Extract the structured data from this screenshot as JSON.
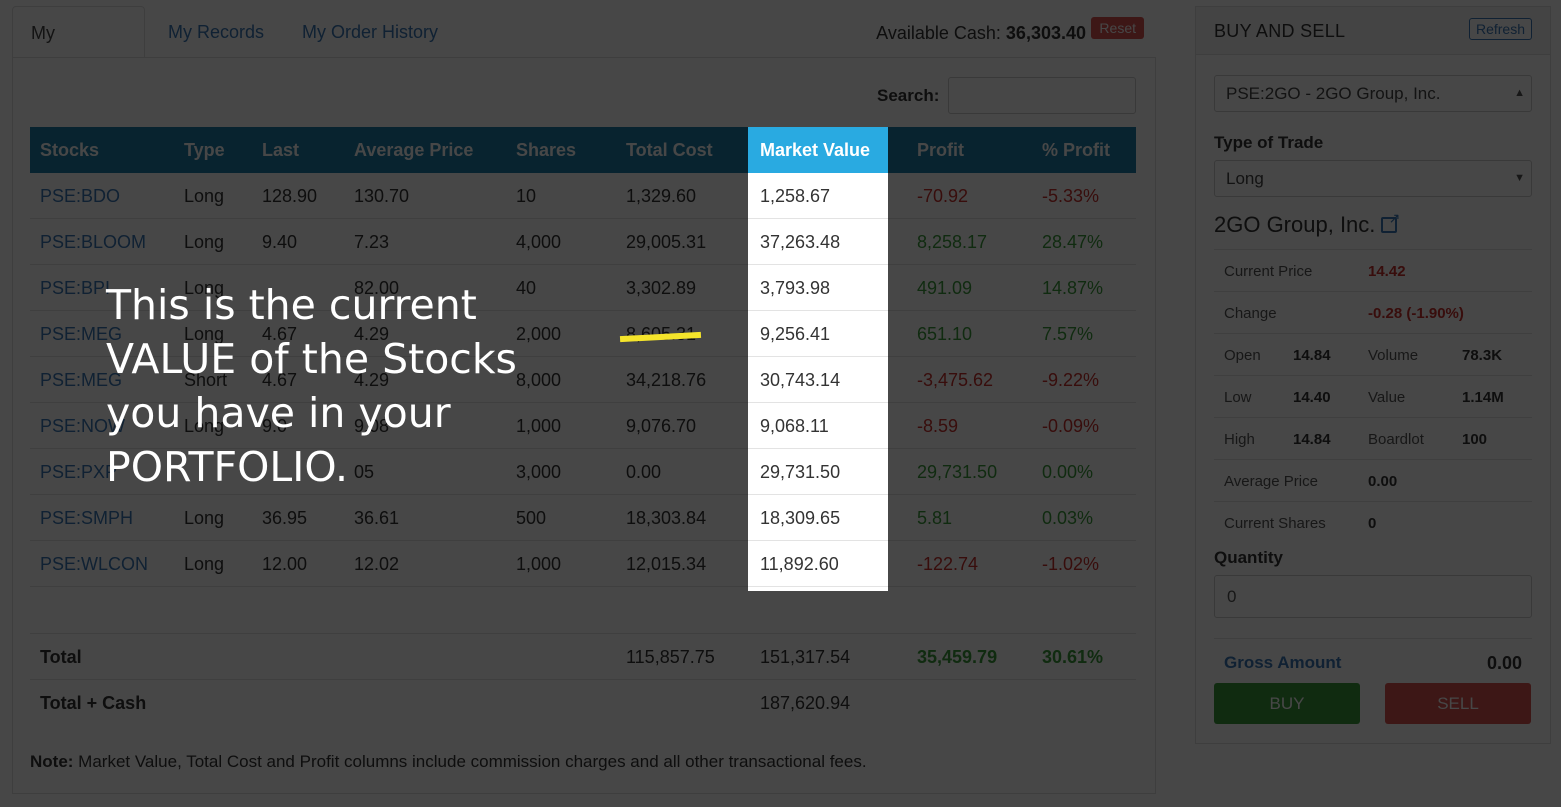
{
  "tabs": [
    "My Portfolio",
    "My Records",
    "My Order History"
  ],
  "cash": {
    "label": "Available Cash:",
    "value": "36,303.40",
    "reset_label": "Reset"
  },
  "search": {
    "label": "Search:",
    "value": ""
  },
  "table": {
    "columns": [
      "Stocks",
      "Type",
      "Last",
      "Average Price",
      "Shares",
      "Total Cost",
      "Market Value",
      "Profit",
      "% Profit"
    ],
    "rows": [
      {
        "stock": "PSE:BDO",
        "type": "Long",
        "last": "128.90",
        "avg": "130.70",
        "shares": "10",
        "cost": "1,329.60",
        "mv": "1,258.67",
        "profit": "-70.92",
        "pct": "-5.33%"
      },
      {
        "stock": "PSE:BLOOM",
        "type": "Long",
        "last": "9.40",
        "avg": "7.23",
        "shares": "4,000",
        "cost": "29,005.31",
        "mv": "37,263.48",
        "profit": "8,258.17",
        "pct": "28.47%"
      },
      {
        "stock": "PSE:BPI",
        "type": "Long",
        "last": "",
        "avg": "82.00",
        "shares": "40",
        "cost": "3,302.89",
        "mv": "3,793.98",
        "profit": "491.09",
        "pct": "14.87%"
      },
      {
        "stock": "PSE:MEG",
        "type": "Long",
        "last": "4.67",
        "avg": "4.29",
        "shares": "2,000",
        "cost": "8,605.31",
        "mv": "9,256.41",
        "profit": "651.10",
        "pct": "7.57%"
      },
      {
        "stock": "PSE:MEG",
        "type": "Short",
        "last": "4.67",
        "avg": "4.29",
        "shares": "8,000",
        "cost": "34,218.76",
        "mv": "30,743.14",
        "profit": "-3,475.62",
        "pct": "-9.22%"
      },
      {
        "stock": "PSE:NOW",
        "type": "Long",
        "last": "9.0",
        "avg": "9.08",
        "shares": "1,000",
        "cost": "9,076.70",
        "mv": "9,068.11",
        "profit": "-8.59",
        "pct": "-0.09%"
      },
      {
        "stock": "PSE:PXP",
        "type": "",
        "last": "",
        "avg": "05",
        "shares": "3,000",
        "cost": "0.00",
        "mv": "29,731.50",
        "profit": "29,731.50",
        "pct": "0.00%"
      },
      {
        "stock": "PSE:SMPH",
        "type": "Long",
        "last": "36.95",
        "avg": "36.61",
        "shares": "500",
        "cost": "18,303.84",
        "mv": "18,309.65",
        "profit": "5.81",
        "pct": "0.03%"
      },
      {
        "stock": "PSE:WLCON",
        "type": "Long",
        "last": "12.00",
        "avg": "12.02",
        "shares": "1,000",
        "cost": "12,015.34",
        "mv": "11,892.60",
        "profit": "-122.74",
        "pct": "-1.02%"
      }
    ],
    "total": {
      "label": "Total",
      "cost": "115,857.75",
      "mv": "151,317.54",
      "profit": "35,459.79",
      "pct": "30.61%"
    },
    "total_cash": {
      "label": "Total + Cash",
      "mv": "187,620.94"
    }
  },
  "note": {
    "label": "Note:",
    "text": " Market Value, Total Cost and Profit columns include commission charges and all other transactional fees."
  },
  "trade": {
    "title": "BUY AND SELL",
    "refresh_label": "Refresh",
    "selected_stock": "PSE:2GO - 2GO Group, Inc.",
    "type_label": "Type of Trade",
    "type_value": "Long",
    "company": "2GO Group, Inc.",
    "current_price_label": "Current Price",
    "current_price": "14.42",
    "change_label": "Change",
    "change": "-0.28 (-1.90%)",
    "open_label": "Open",
    "open": "14.84",
    "volume_label": "Volume",
    "volume": "78.3K",
    "low_label": "Low",
    "low": "14.40",
    "value_label": "Value",
    "value": "1.14M",
    "high_label": "High",
    "high": "14.84",
    "boardlot_label": "Boardlot",
    "boardlot": "100",
    "avg_price_label": "Average Price",
    "avg_price": "0.00",
    "shares_label": "Current Shares",
    "shares": "0",
    "quantity_label": "Quantity",
    "quantity": "0",
    "gross_label": "Gross Amount",
    "gross": "0.00",
    "buy_label": "BUY",
    "sell_label": "SELL"
  },
  "callout": "This is the current\nVALUE of the Stocks\nyou have in your\nPORTFOLIO.",
  "colors": {
    "header": "#1e7ea8",
    "highlight": "#29aae1",
    "pointer": "#f5e52b",
    "buy": "#3c9a3c",
    "sell": "#d9534f"
  }
}
